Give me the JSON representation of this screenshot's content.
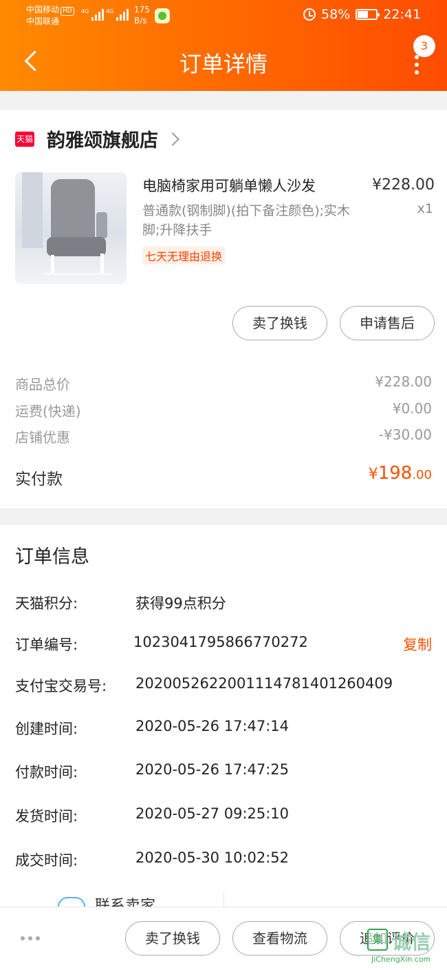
{
  "status_bar": {
    "carrier1": "中国移动",
    "hd": "HD",
    "carrier2": "中国联通",
    "net1": "4G",
    "net2": "4G",
    "speed_value": "175",
    "speed_unit": "B/s",
    "battery_percent": "58%",
    "battery_level": 0.58,
    "time": "22:41"
  },
  "header": {
    "title": "订单详情",
    "badge_count": "3"
  },
  "shop": {
    "platform_tag": "天猫",
    "name": "韵雅颂旗舰店"
  },
  "product": {
    "name": "电脑椅家用可躺单懒人沙发",
    "spec": "普通款(钢制脚)(拍下备注颜色);实木脚;升降扶手",
    "tag": "七天无理由退换",
    "price": "¥228.00",
    "qty": "x1"
  },
  "item_actions": {
    "sell_label": "卖了换钱",
    "after_sale_label": "申请售后"
  },
  "fees": [
    {
      "label": "商品总价",
      "value": "¥228.00"
    },
    {
      "label": "运费(快递)",
      "value": "¥0.00"
    },
    {
      "label": "店铺优惠",
      "value": "-¥30.00"
    }
  ],
  "paid": {
    "label": "实付款",
    "currency": "¥",
    "integer": "198",
    "decimal": ".00"
  },
  "order_info": {
    "title": "订单信息",
    "copy_label": "复制",
    "rows": [
      {
        "label": "天猫积分:",
        "value": "获得99点积分"
      },
      {
        "label": "订单编号:",
        "value": "1023041795866770272"
      },
      {
        "label": "支付宝交易号:",
        "value": "2020052622001114781401260409"
      },
      {
        "label": "创建时间:",
        "value": "2020-05-26 17:47:14"
      },
      {
        "label": "付款时间:",
        "value": "2020-05-26 17:47:25"
      },
      {
        "label": "发货时间:",
        "value": "2020-05-27 09:25:10"
      },
      {
        "label": "成交时间:",
        "value": "2020-05-30 10:02:52"
      }
    ]
  },
  "contact": {
    "label": "联系卖家"
  },
  "bottom_bar": {
    "sell_label": "卖了换钱",
    "logistics_label": "查看物流",
    "review_label": "追加评价"
  },
  "watermark": {
    "icon_text": "集",
    "text": "诚信",
    "url": "JiChengXin.com"
  }
}
